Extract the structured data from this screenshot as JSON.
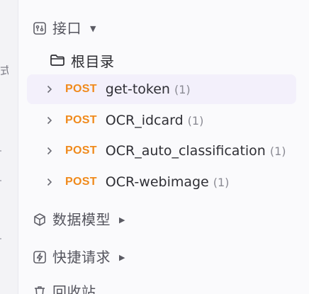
{
  "rail": {
    "partial_glyph": "式"
  },
  "tree": {
    "api_section": {
      "label": "接口",
      "icon": "api-icon",
      "caret": "▼"
    },
    "root_folder": {
      "label": "根目录",
      "icon": "folder-icon"
    },
    "apis": [
      {
        "method": "POST",
        "name": "get-token",
        "count": "(1)",
        "selected": true
      },
      {
        "method": "POST",
        "name": "OCR_idcard",
        "count": "(1)",
        "selected": false
      },
      {
        "method": "POST",
        "name": "OCR_auto_classification",
        "count": "(1)",
        "selected": false
      },
      {
        "method": "POST",
        "name": "OCR-webimage",
        "count": "(1)",
        "selected": false
      }
    ],
    "model_section": {
      "label": "数据模型",
      "icon": "cube-icon",
      "caret": "▶"
    },
    "quick_section": {
      "label": "快捷请求",
      "icon": "lightning-icon",
      "caret": "▶"
    },
    "trash_section": {
      "label": "回收站",
      "icon": "trash-icon"
    }
  },
  "colors": {
    "method_post": "#f08a1c",
    "selected_row_bg": "#f3f0fb"
  }
}
